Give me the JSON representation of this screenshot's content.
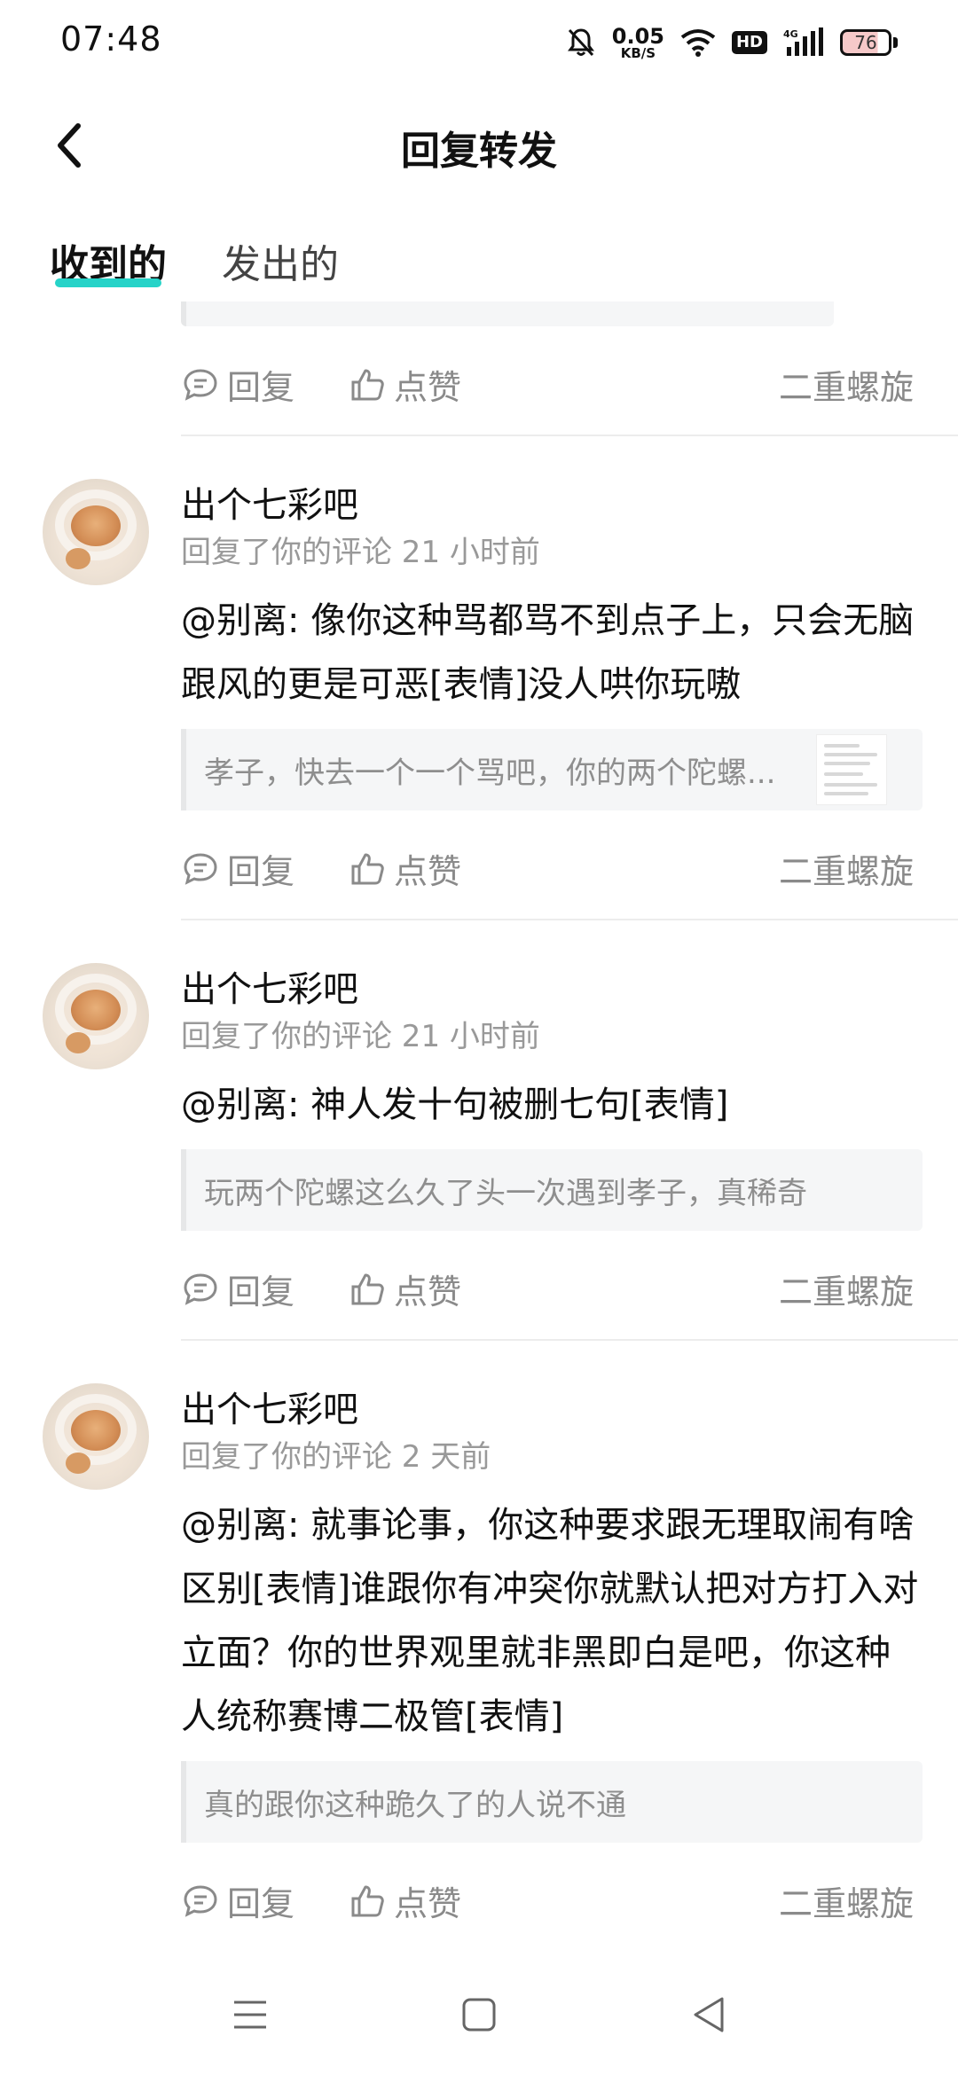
{
  "status_bar": {
    "time": "07:48",
    "net_speed_value": "0.05",
    "net_speed_unit": "KB/S",
    "hd_label": "HD",
    "network": "4G",
    "battery": "76"
  },
  "header": {
    "title": "回复转发"
  },
  "tabs": [
    {
      "label": "收到的",
      "active": true
    },
    {
      "label": "发出的",
      "active": false
    }
  ],
  "actions": {
    "reply_label": "回复",
    "like_label": "点赞",
    "source_label": "二重螺旋"
  },
  "items": [
    {
      "name": "出个七彩吧",
      "meta": "回复了你的评论 21 小时前",
      "text": "@别离: 像你这种骂都骂不到点子上，只会无脑跟风的更是可恶[表情]没人哄你玩嗷",
      "quote": "孝子，快去一个一个骂吧，你的两个陀螺...",
      "has_thumb": true
    },
    {
      "name": "出个七彩吧",
      "meta": "回复了你的评论 21 小时前",
      "text": "@别离: 神人发十句被删七句[表情]",
      "quote": "玩两个陀螺这么久了头一次遇到孝子，真稀奇",
      "has_thumb": false
    },
    {
      "name": "出个七彩吧",
      "meta": "回复了你的评论 2 天前",
      "text": "@别离: 就事论事，你这种要求跟无理取闹有啥区别[表情]谁跟你有冲突你就默认把对方打入对立面？你的世界观里就非黑即白是吧，你这种人统称赛博二极管[表情]",
      "quote": "真的跟你这种跪久了的人说不通",
      "has_thumb": false
    }
  ]
}
